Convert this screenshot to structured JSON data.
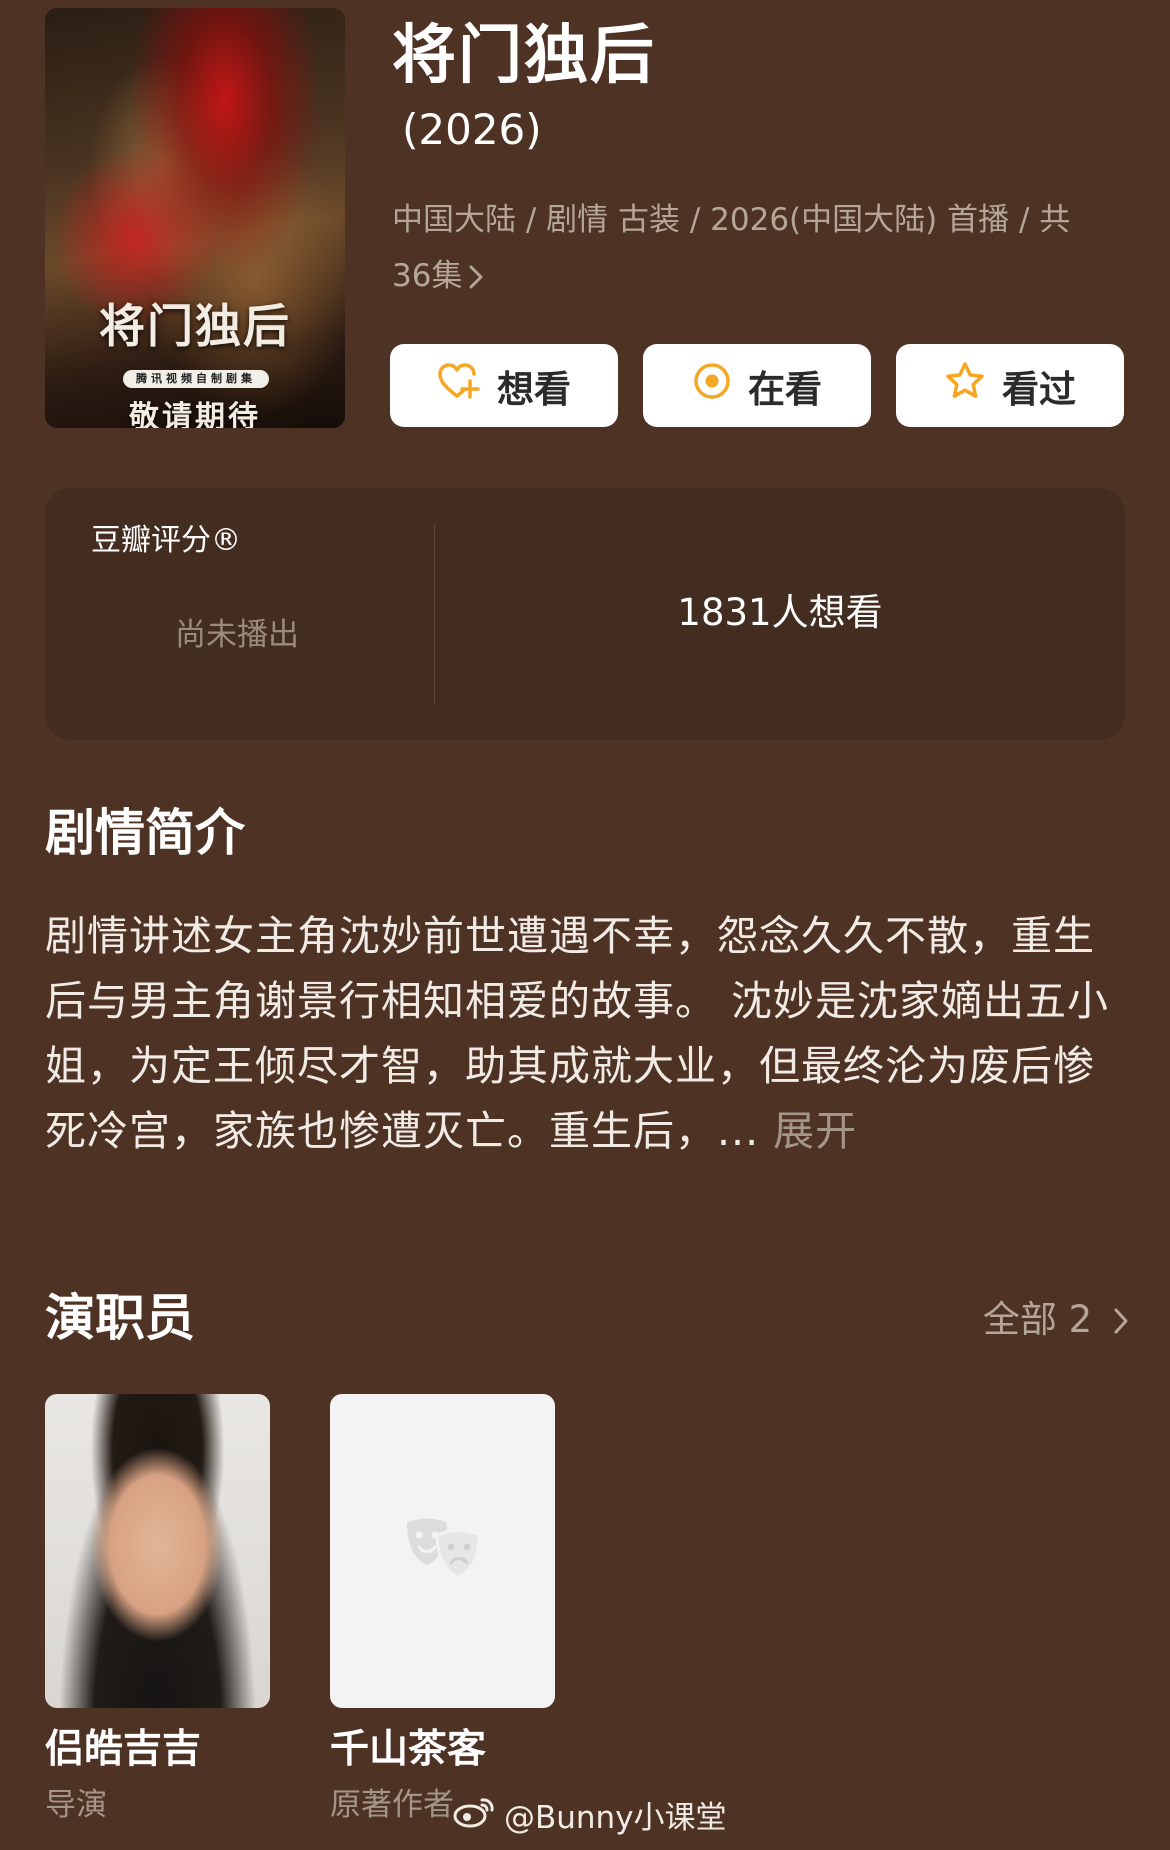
{
  "poster": {
    "title": "将门独后",
    "badge": "腾讯视频自制剧集",
    "tagline": "敬请期待"
  },
  "header": {
    "title": "将门独后",
    "year": "(2026)",
    "meta": "中国大陆 / 剧情 古装 / 2026(中国大陆) 首播 / 共 36集"
  },
  "actions": [
    {
      "label": "想看",
      "icon": "heart-plus-icon",
      "color": "#f5a623"
    },
    {
      "label": "在看",
      "icon": "target-circle-icon",
      "color": "#f5a623"
    },
    {
      "label": "看过",
      "icon": "star-icon",
      "color": "#f5a623"
    }
  ],
  "rating": {
    "label": "豆瓣评分®",
    "status": "尚未播出",
    "want_count": "1831人想看"
  },
  "synopsis": {
    "title": "剧情简介",
    "text": "剧情讲述女主角沈妙前世遭遇不幸，怨念久久不散，重生后与男主角谢景行相知相爱的故事。 沈妙是沈家嫡出五小姐，为定王倾尽才智，助其成就大业，但最终沦为废后惨死冷宫，家族也惨遭灭亡。重生后，...",
    "expand": "展开"
  },
  "cast": {
    "title": "演职员",
    "all_link": "全部 2",
    "members": [
      {
        "name": "侣皓吉吉",
        "role": "导演"
      },
      {
        "name": "千山茶客",
        "role": "原著作者"
      }
    ]
  },
  "watermark": "@Bunny小课堂"
}
